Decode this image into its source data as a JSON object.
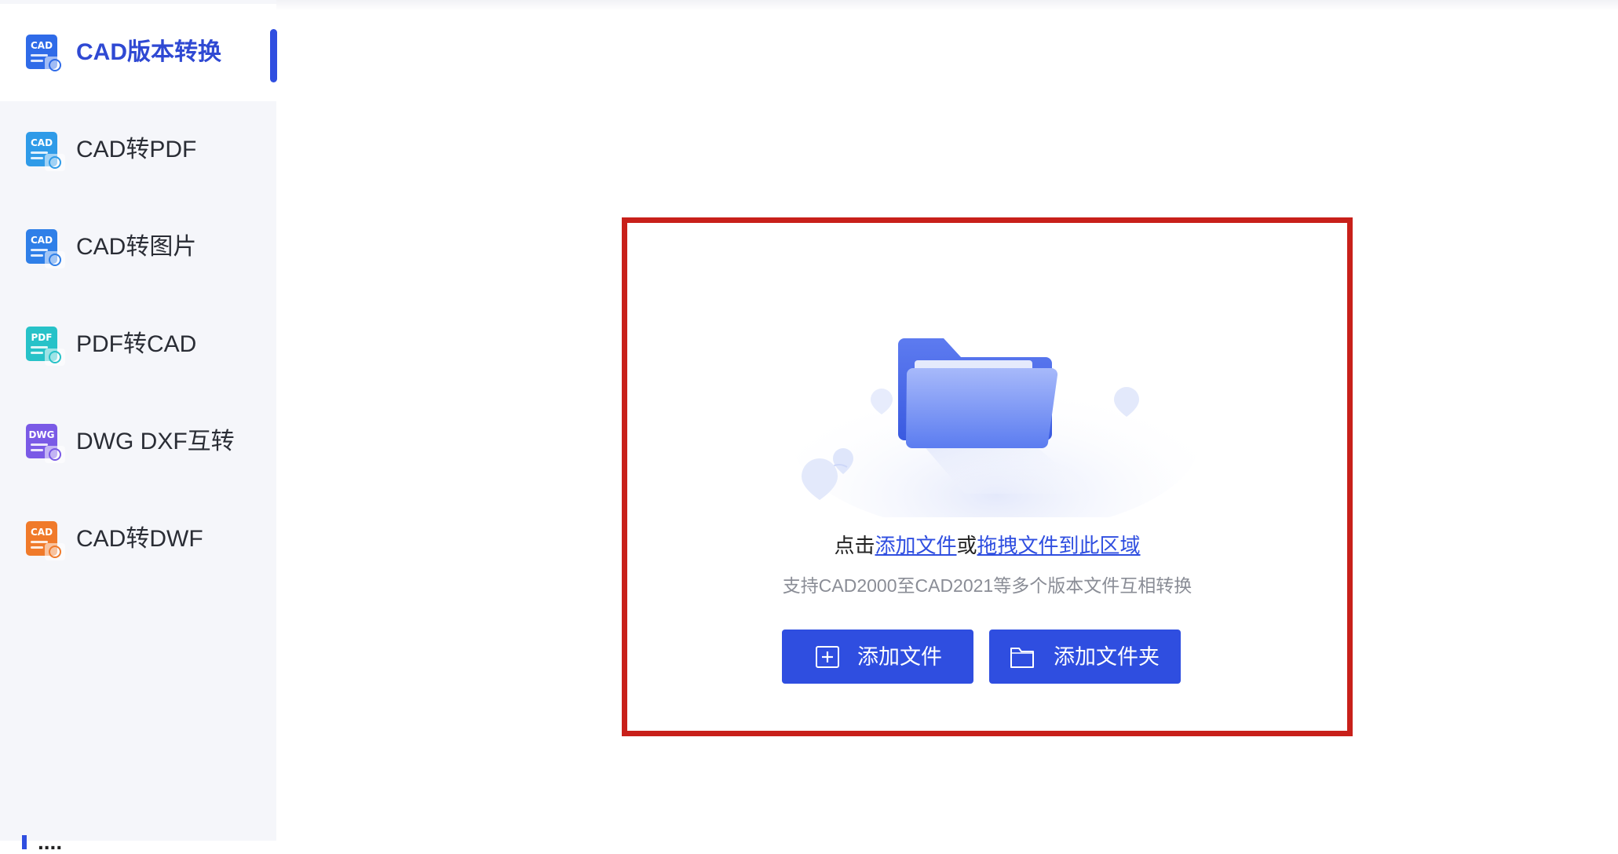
{
  "sidebar": {
    "items": [
      {
        "label": "CAD版本转换",
        "icon": "cad-version-icon",
        "icon_text": "CAD",
        "color": "#2f6be8",
        "active": true
      },
      {
        "label": "CAD转PDF",
        "icon": "cad-to-pdf-icon",
        "icon_text": "CAD",
        "color": "#2f9be8",
        "active": false
      },
      {
        "label": "CAD转图片",
        "icon": "cad-to-image-icon",
        "icon_text": "CAD",
        "color": "#2f7fe8",
        "active": false
      },
      {
        "label": "PDF转CAD",
        "icon": "pdf-to-cad-icon",
        "icon_text": "PDF",
        "color": "#27c2c8",
        "active": false
      },
      {
        "label": "DWG DXF互转",
        "icon": "dwg-dxf-icon",
        "icon_text": "DWG",
        "color": "#7a5ae6",
        "active": false
      },
      {
        "label": "CAD转DWF",
        "icon": "cad-to-dwf-icon",
        "icon_text": "CAD",
        "color": "#f07a2a",
        "active": false
      }
    ],
    "section_peek": "...."
  },
  "dropzone": {
    "hint_prefix": "点击",
    "hint_link1": "添加文件",
    "hint_middle": "或",
    "hint_link2": "拖拽文件到此区域",
    "subtext": "支持CAD2000至CAD2021等多个版本文件互相转换",
    "illustration": "folder-icon"
  },
  "buttons": {
    "add_file": "添加文件",
    "add_folder": "添加文件夹"
  },
  "colors": {
    "accent": "#2f4ee0",
    "highlight_border": "#c8201a",
    "sidebar_bg": "#f5f6fa"
  }
}
